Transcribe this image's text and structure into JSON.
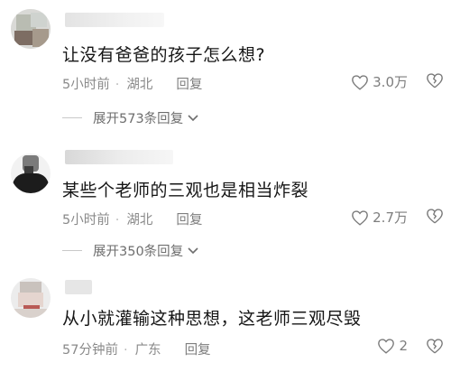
{
  "comments": [
    {
      "text": "让没有爸爸的孩子怎么想?",
      "time": "5小时前",
      "location": "湖北",
      "reply_label": "回复",
      "likes": "3.0万",
      "expand_label": "展开573条回复"
    },
    {
      "text": "某些个老师的三观也是相当炸裂",
      "time": "5小时前",
      "location": "湖北",
      "reply_label": "回复",
      "likes": "2.7万",
      "expand_label": "展开350条回复"
    },
    {
      "text": "从小就灌输这种思想，这老师三观尽毁",
      "time": "57分钟前",
      "location": "广东",
      "reply_label": "回复",
      "likes": "2"
    }
  ],
  "icons": {
    "like": "heart-outline-icon",
    "dislike": "broken-heart-icon",
    "expand": "chevron-down-icon"
  },
  "colors": {
    "meta": "#8a8a8a",
    "text": "#161616",
    "background": "#ffffff"
  }
}
